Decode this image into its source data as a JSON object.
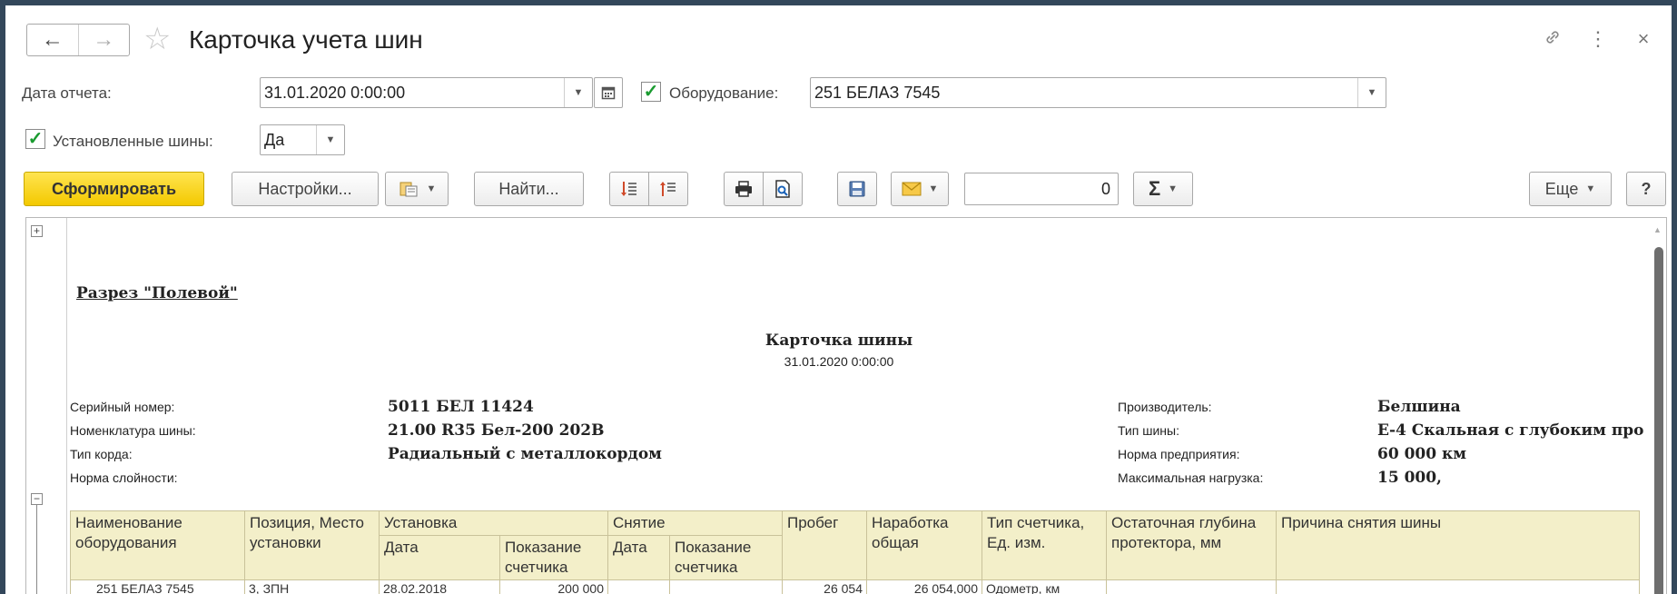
{
  "window": {
    "title": "Карточка учета шин",
    "icons": {
      "back": "arrow-left-icon",
      "forward": "arrow-right-icon",
      "favorite": "star-icon",
      "link": "link-icon",
      "more": "more-vertical-icon",
      "close": "close-icon"
    }
  },
  "params": {
    "report_date_label": "Дата отчета:",
    "report_date_value": "31.01.2020  0:00:00",
    "equipment_checked": true,
    "equipment_label": "Оборудование:",
    "equipment_value": "251 БЕЛАЗ 7545",
    "installed_checked": true,
    "installed_label": "Установленные шины:",
    "installed_value": "Да"
  },
  "toolbar": {
    "generate": "Сформировать",
    "settings": "Настройки...",
    "find": "Найти...",
    "counter_value": "0",
    "sum_symbol": "Σ",
    "more": "Еще",
    "help": "?"
  },
  "report": {
    "section": "Разрез \"Полевой\"",
    "card_title": "Карточка шины",
    "card_date": "31.01.2020 0:00:00",
    "left_fields": [
      {
        "label": "Серийный номер:",
        "value": "5011 БЕЛ 11424"
      },
      {
        "label": "Номенклатура шины:",
        "value": "21.00 R35  Бел-200  202В"
      },
      {
        "label": "Тип корда:",
        "value": "Радиальный с металлокордом"
      },
      {
        "label": "Норма слойности:",
        "value": ""
      }
    ],
    "right_fields": [
      {
        "label": "Производитель:",
        "value": "Белшина"
      },
      {
        "label": "Тип шины:",
        "value": "Е-4 Скальная с глубоким про"
      },
      {
        "label": "Норма предприятия:",
        "value": "60 000 км"
      },
      {
        "label": "Максимальная нагрузка:",
        "value": "15 000,"
      }
    ],
    "table": {
      "headers": {
        "equipment": "Наименование оборудования",
        "position": "Позиция, Место установки",
        "install": "Установка",
        "removal": "Снятие",
        "mileage": "Пробег",
        "runtime": "Наработка общая",
        "counter_type": "Тип счетчика, Ед. изм.",
        "tread": "Остаточная глубина протектора, мм",
        "reason": "Причина снятия шины",
        "date": "Дата",
        "reading": "Показание счетчика"
      },
      "rows": [
        {
          "equipment": "251 БЕЛАЗ 7545",
          "position": "3, ЗПН",
          "install_date": "28.02.2018",
          "install_reading": "200 000",
          "remove_date": "",
          "remove_reading": "",
          "mileage": "26 054",
          "runtime": "26 054,000",
          "counter_type": "Одометр, км",
          "tread": "",
          "reason": ""
        }
      ]
    }
  }
}
